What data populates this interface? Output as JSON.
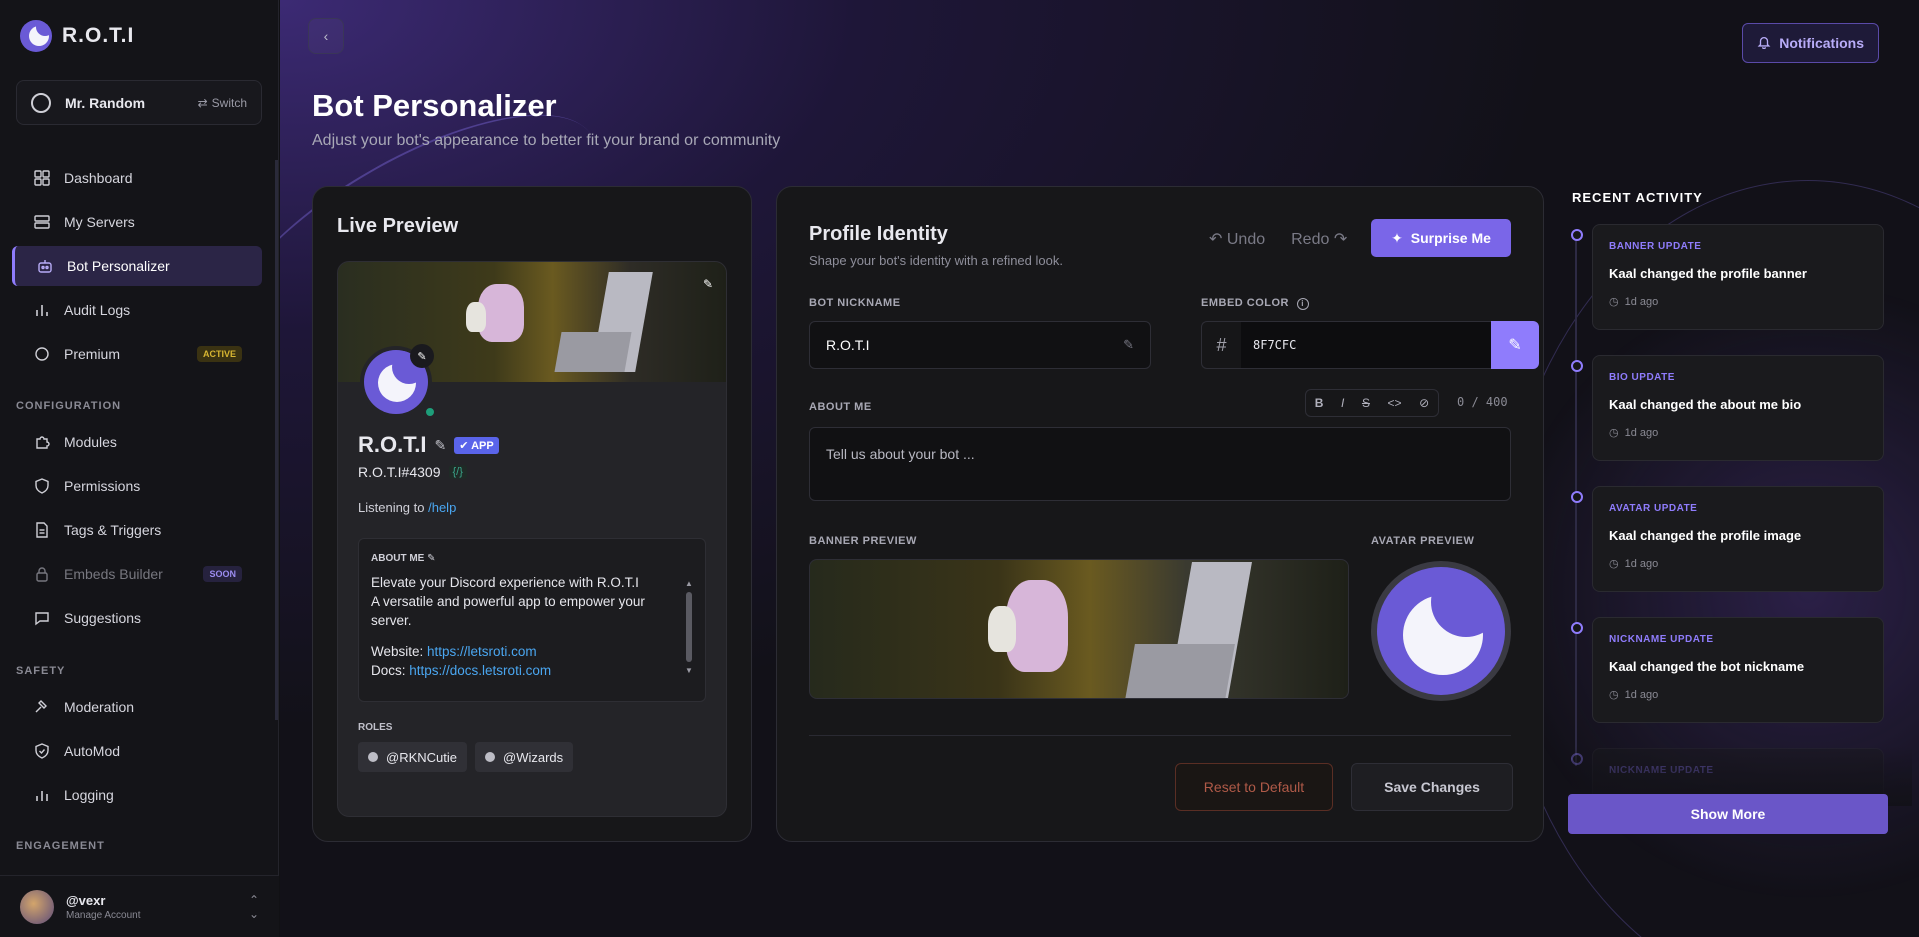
{
  "app": {
    "name": "R.O.T.I"
  },
  "server": {
    "name": "Mr. Random",
    "switch_label": "Switch"
  },
  "nav": {
    "main": [
      {
        "label": "Dashboard"
      },
      {
        "label": "My Servers"
      },
      {
        "label": "Bot Personalizer"
      },
      {
        "label": "Audit Logs"
      },
      {
        "label": "Premium",
        "badge": "ACTIVE"
      }
    ],
    "configuration_title": "CONFIGURATION",
    "configuration": [
      {
        "label": "Modules"
      },
      {
        "label": "Permissions"
      },
      {
        "label": "Tags & Triggers"
      },
      {
        "label": "Embeds Builder",
        "badge": "SOON"
      },
      {
        "label": "Suggestions"
      }
    ],
    "safety_title": "SAFETY",
    "safety": [
      {
        "label": "Moderation"
      },
      {
        "label": "AutoMod"
      },
      {
        "label": "Logging"
      }
    ],
    "engagement_title": "ENGAGEMENT"
  },
  "user": {
    "handle": "@vexr",
    "sub": "Manage Account"
  },
  "header": {
    "notifications": "Notifications",
    "title": "Bot Personalizer",
    "subtitle": "Adjust your bot's appearance to better fit your brand or community"
  },
  "preview": {
    "title": "Live Preview",
    "bot_name": "R.O.T.I",
    "app_badge": "APP",
    "tag": "R.O.T.I#4309",
    "code_chip": "{/}",
    "listening_prefix": "Listening to ",
    "listening_cmd": "/help",
    "about_title": "ABOUT ME",
    "about_line1": "Elevate your Discord experience with R.O.T.I",
    "about_line2": "A versatile and powerful app to empower your server.",
    "website_label": "Website: ",
    "website_url": "https://letsroti.com",
    "docs_label": "Docs: ",
    "docs_url": "https://docs.letsroti.com",
    "roles_title": "ROLES",
    "roles": [
      "@RKNCutie",
      "@Wizards"
    ]
  },
  "identity": {
    "title": "Profile Identity",
    "subtitle": "Shape your bot's identity with a refined look.",
    "undo": "Undo",
    "redo": "Redo",
    "surprise": "Surprise Me",
    "nickname_label": "BOT NICKNAME",
    "nickname_value": "R.O.T.I",
    "embed_label": "EMBED COLOR",
    "embed_value": "8F7CFC",
    "about_label": "ABOUT ME",
    "counter": "0 / 400",
    "about_placeholder": "Tell us about your bot ...",
    "banner_label": "BANNER PREVIEW",
    "avatar_label": "AVATAR PREVIEW",
    "reset": "Reset to Default",
    "save": "Save Changes"
  },
  "activity": {
    "title": "RECENT ACTIVITY",
    "items": [
      {
        "type": "BANNER UPDATE",
        "text": "Kaal changed the profile banner",
        "time": "1d ago"
      },
      {
        "type": "BIO UPDATE",
        "text": "Kaal changed the about me bio",
        "time": "1d ago"
      },
      {
        "type": "AVATAR UPDATE",
        "text": "Kaal changed the profile image",
        "time": "1d ago"
      },
      {
        "type": "NICKNAME UPDATE",
        "text": "Kaal changed the bot nickname",
        "time": "1d ago"
      },
      {
        "type": "NICKNAME UPDATE"
      }
    ],
    "show_more": "Show More"
  },
  "colors": {
    "accent": "#8F7CFC",
    "background": "#111114",
    "status_online": "#1E9E7A"
  }
}
